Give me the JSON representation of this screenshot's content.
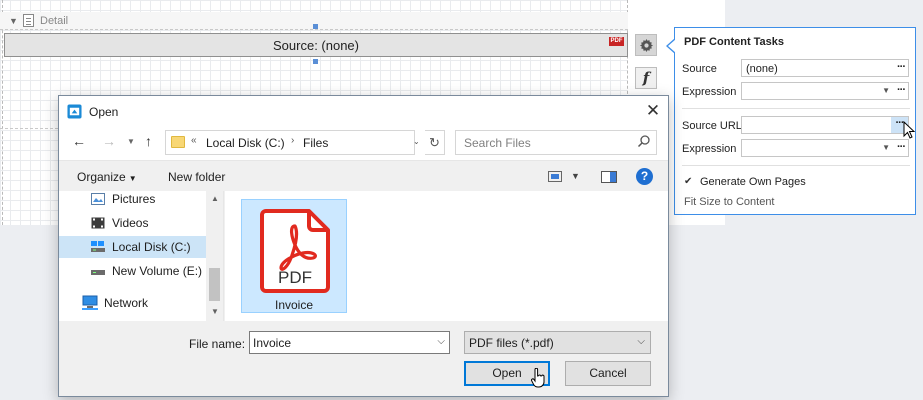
{
  "band": {
    "label": "Detail"
  },
  "pdf_control": {
    "source_text": "Source: (none)",
    "badge": "PDF"
  },
  "side_buttons": {
    "function_glyph": "f"
  },
  "tasks_panel": {
    "title": "PDF Content Tasks",
    "source_label": "Source",
    "source_value": "(none)",
    "expression_label_1": "Expression",
    "source_url_label": "Source URL",
    "expression_label_2": "Expression",
    "ellipsis": "···",
    "generate_own_pages_label": "Generate Own Pages",
    "generate_own_pages_checked": true,
    "fit_size_link": "Fit Size to Content"
  },
  "dialog": {
    "title": "Open",
    "address": {
      "overflow": "«",
      "drive": "Local Disk (C:)",
      "folder": "Files"
    },
    "search_placeholder": "Search Files",
    "organize_label": "Organize",
    "new_folder_label": "New folder",
    "nav_items": [
      {
        "label": "Pictures",
        "icon": "pictures-icon"
      },
      {
        "label": "Videos",
        "icon": "videos-icon"
      },
      {
        "label": "Local Disk (C:)",
        "icon": "drive-icon",
        "selected": true
      },
      {
        "label": "New Volume (E:)",
        "icon": "drive-icon"
      },
      {
        "label": "Network",
        "icon": "network-icon"
      }
    ],
    "file": {
      "name": "Invoice",
      "type_badge": "PDF"
    },
    "file_name_label": "File name:",
    "file_name_value": "Invoice",
    "filter_value": "PDF files (*.pdf)",
    "open_button": "Open",
    "cancel_button": "Cancel"
  },
  "colors": {
    "accent": "#0078d7",
    "pdf_red": "#e12a1f",
    "selection": "#cce8ff"
  }
}
